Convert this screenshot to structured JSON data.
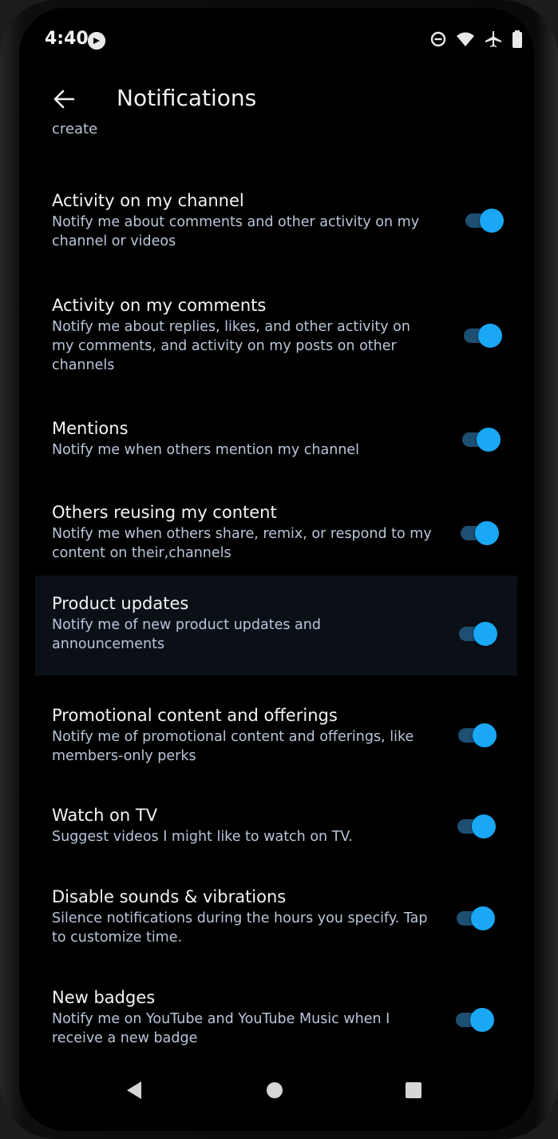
{
  "status_bar": {
    "time": "4:40",
    "icons": [
      "app-notification-icon",
      "do-not-disturb-icon",
      "wifi-icon",
      "airplane-mode-icon",
      "battery-icon"
    ]
  },
  "header": {
    "title": "Notifications",
    "back_icon": "back-arrow-icon"
  },
  "partial_text": "create",
  "settings": [
    {
      "title": "Activity on my channel",
      "description": "Notify me about comments and other activity on my channel or videos",
      "enabled": true
    },
    {
      "title": "Activity on my comments",
      "description": "Notify me about replies, likes, and other activity on my comments, and activity on my posts on other channels",
      "enabled": true
    },
    {
      "title": "Mentions",
      "description": "Notify me when others mention my channel",
      "enabled": true
    },
    {
      "title": "Others reusing my content",
      "description": "Notify me when others share, remix, or respond to my content on their,channels",
      "enabled": true
    },
    {
      "title": "Product updates",
      "description": "Notify me of new product updates and announcements",
      "enabled": true
    },
    {
      "title": "Promotional content and offerings",
      "description": "Notify me of promotional content and offerings, like members-only perks",
      "enabled": true
    },
    {
      "title": "Watch on TV",
      "description": "Suggest videos I might like to watch on TV.",
      "enabled": true
    },
    {
      "title": "Disable sounds & vibrations",
      "description": "Silence notifications during the hours you specify. Tap to customize time.",
      "enabled": true
    },
    {
      "title": "New badges",
      "description": "Notify me on YouTube and YouTube Music when I receive a new badge",
      "enabled": true
    }
  ],
  "colors": {
    "background": "#000000",
    "title_text": "#f4f4f4",
    "description_text": "#b9c5d9",
    "toggle_thumb": "#1aa7f5",
    "toggle_track": "#1e4f73",
    "highlight_row": "#0b1017"
  },
  "nav_bar": {
    "icons": [
      "nav-back-icon",
      "nav-home-icon",
      "nav-recents-icon"
    ]
  }
}
